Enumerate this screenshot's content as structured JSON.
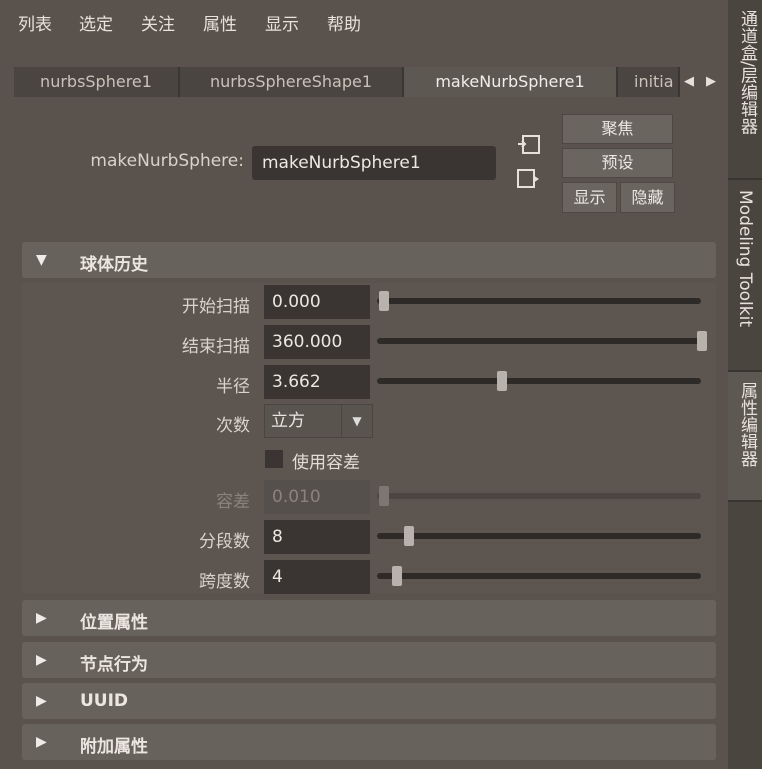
{
  "menu": [
    "列表",
    "选定",
    "关注",
    "属性",
    "显示",
    "帮助"
  ],
  "tabs": [
    "nurbsSphere1",
    "nurbsSphereShape1",
    "makeNurbSphere1",
    "initia"
  ],
  "active_tab": "makeNurbSphere1",
  "node": {
    "label": "makeNurbSphere:",
    "value": "makeNurbSphere1"
  },
  "buttons": {
    "focus": "聚焦",
    "preset": "预设",
    "show": "显示",
    "hide": "隐藏"
  },
  "sections": {
    "sphere_history": "球体历史",
    "transform_attrs": "位置属性",
    "node_behavior": "节点行为",
    "uuid": "UUID",
    "extra_attrs": "附加属性"
  },
  "attributes": {
    "start_sweep": {
      "label": "开始扫描",
      "value": "0.000",
      "slider": 0.0
    },
    "end_sweep": {
      "label": "结束扫描",
      "value": "360.000",
      "slider": 1.0
    },
    "radius": {
      "label": "半径",
      "value": "3.662",
      "slider": 0.37
    },
    "degree": {
      "label": "次数",
      "value": "立方"
    },
    "use_tolerance": {
      "label": "使用容差",
      "checked": false
    },
    "tolerance": {
      "label": "容差",
      "value": "0.010",
      "slider": 0.0,
      "enabled": false
    },
    "sections": {
      "label": "分段数",
      "value": "8",
      "slider": 0.08
    },
    "spans": {
      "label": "跨度数",
      "value": "4",
      "slider": 0.04
    }
  },
  "sidebar_tabs": [
    "通道盒/层编辑器",
    "Modeling Toolkit",
    "属性编辑器"
  ],
  "active_sidebar_tab": "属性编辑器",
  "icons": {
    "tab_left": "chevron-left-icon",
    "tab_right": "chevron-right-icon",
    "expand": "triangle-down-icon",
    "collapse": "triangle-right-icon",
    "dropdown": "chevron-down-icon"
  }
}
